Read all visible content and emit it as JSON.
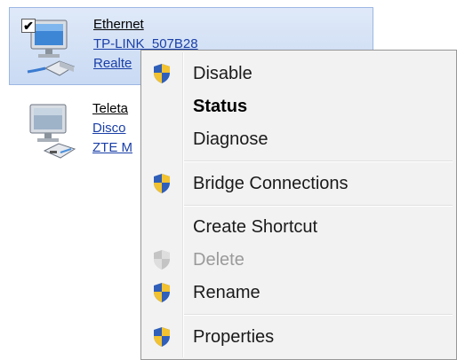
{
  "connections": [
    {
      "name": "Ethernet",
      "network": "TP-LINK_507B28",
      "adapter": "Realte",
      "checked": true,
      "icon": "wired-network-adapter-icon"
    },
    {
      "name": "Teleta",
      "network": "Disco",
      "adapter": "ZTE M",
      "icon": "modem-network-adapter-icon"
    }
  ],
  "checkbox_glyph": "✔",
  "menu": {
    "items": [
      {
        "label": "Disable",
        "icon": "uac-shield-icon"
      },
      {
        "label": "Status",
        "bold": true
      },
      {
        "label": "Diagnose"
      },
      {
        "label": "Bridge Connections",
        "icon": "uac-shield-icon"
      },
      {
        "label": "Create Shortcut"
      },
      {
        "label": "Delete",
        "icon": "uac-shield-icon",
        "disabled": true
      },
      {
        "label": "Rename",
        "icon": "uac-shield-icon"
      },
      {
        "label": "Properties",
        "icon": "uac-shield-icon"
      }
    ]
  },
  "colors": {
    "selection_bg": "#c9daf3",
    "selection_border": "#9db7e3",
    "link_blue": "#1a3fa8",
    "menu_bg": "#f2f2f2",
    "disabled_text": "#9a9a9a"
  }
}
